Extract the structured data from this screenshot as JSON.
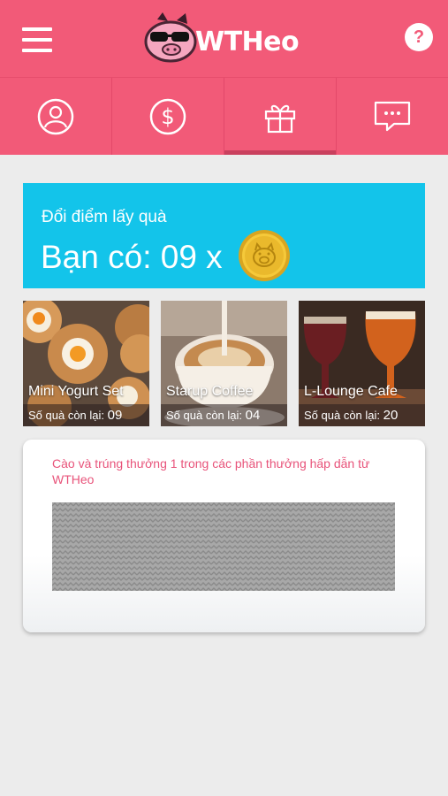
{
  "app": {
    "logo_text": "WTHeo",
    "help_label": "?"
  },
  "tabs": [
    {
      "name": "profile",
      "icon": "user-icon"
    },
    {
      "name": "money",
      "icon": "dollar-icon"
    },
    {
      "name": "gift",
      "icon": "gift-icon",
      "active": true
    },
    {
      "name": "chat",
      "icon": "chat-icon"
    }
  ],
  "points": {
    "caption": "Đổi điểm lấy quà",
    "value_text": "Bạn có: 09 x",
    "coin_icon": "pig-coin-icon"
  },
  "gifts": [
    {
      "name": "Mini Yogurt Set",
      "remain_label": "Số quà còn lại:",
      "remain_count": "09"
    },
    {
      "name": "Starup Coffee",
      "remain_label": "Số quà còn lại:",
      "remain_count": "04"
    },
    {
      "name": "L-Lounge Cafe",
      "remain_label": "Số quà còn lại:",
      "remain_count": "20"
    }
  ],
  "scratch": {
    "text": "Cào và trúng thưởng 1 trong các phần thưởng hấp dẫn từ WTHeo"
  },
  "colors": {
    "brand": "#f25a78",
    "accent": "#13c4ea",
    "text_pink": "#e8537a"
  }
}
